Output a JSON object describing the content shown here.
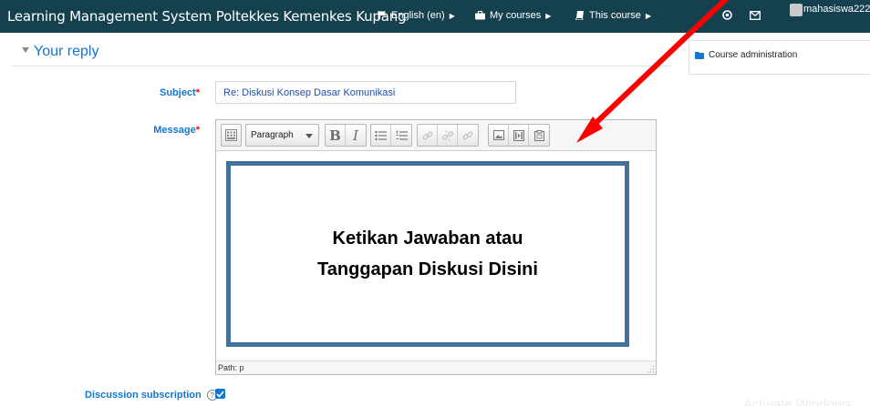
{
  "navbar": {
    "brand": "Learning Management System Poltekkes Kemenkes Kupang",
    "language": "English (en)",
    "my_courses": "My courses",
    "this_course": "This course",
    "user": "mahasiswa222",
    "bg_color": "#15414f"
  },
  "form": {
    "section_title": "Your reply",
    "subject_label": "Subject",
    "subject_value": "Re: Diskusi Konsep Dasar Komunikasi",
    "message_label": "Message",
    "required_mark": "*",
    "discussion_subscription_label": "Discussion subscription",
    "discussion_subscription_checked": true,
    "help_symbol": "?"
  },
  "editor": {
    "paragraph_select": "Paragraph",
    "bold": "B",
    "italic": "I",
    "path": "Path: p",
    "callout_line1": "Ketikan Jawaban atau",
    "callout_line2": "Tanggapan Diskusi Disini"
  },
  "sidebar": {
    "course_administration": "Course administration"
  },
  "watermark": "Activate Windows",
  "colors": {
    "link_blue": "#1177d1",
    "callout_border": "#41719c",
    "arrow_red": "#ff0000",
    "required_red": "#ff0000"
  }
}
